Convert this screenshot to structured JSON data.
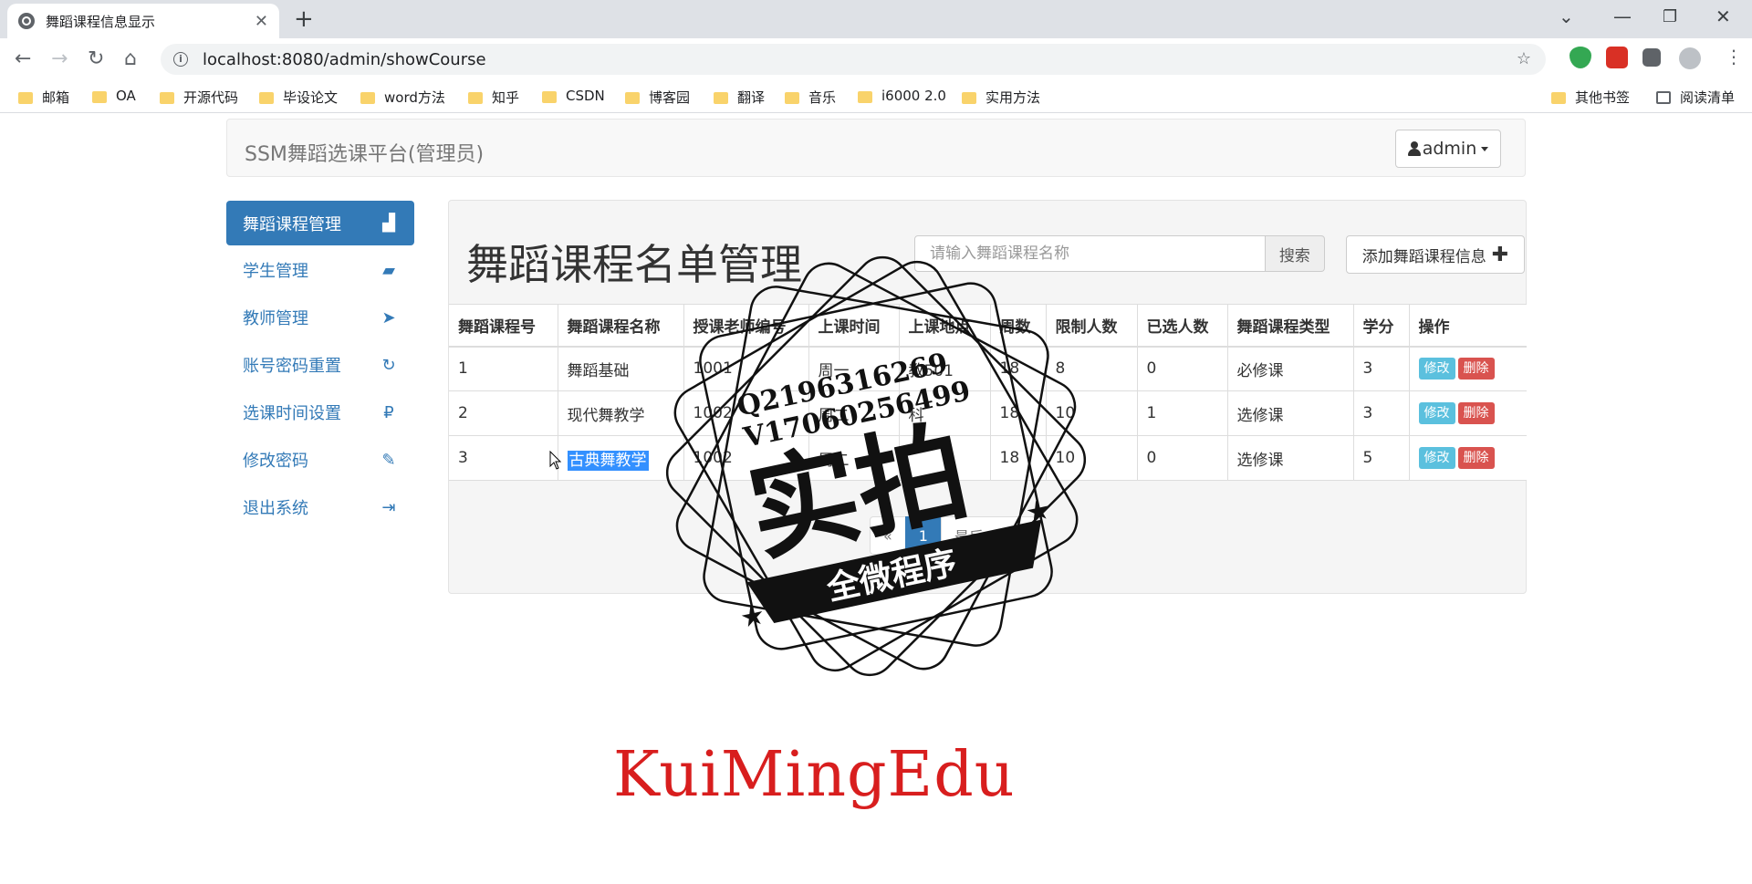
{
  "browser": {
    "tab_title": "舞蹈课程信息显示",
    "url": "localhost:8080/admin/showCourse",
    "bookmarks": [
      "邮箱",
      "OA",
      "开源代码",
      "毕设论文",
      "word方法",
      "知乎",
      "CSDN",
      "博客园",
      "翻译",
      "音乐",
      "i6000 2.0",
      "实用方法"
    ],
    "other_bookmarks": "其他书签",
    "reading_list": "阅读清单"
  },
  "navbar": {
    "brand": "SSM舞蹈选课平台(管理员)",
    "user": "admin"
  },
  "sidebar": {
    "items": [
      {
        "label": "舞蹈课程管理",
        "icon": "bar-chart-icon",
        "glyph": "▟"
      },
      {
        "label": "学生管理",
        "icon": "folder-open-icon",
        "glyph": "📂"
      },
      {
        "label": "教师管理",
        "icon": "send-icon",
        "glyph": "➤"
      },
      {
        "label": "账号密码重置",
        "icon": "refresh-icon",
        "glyph": "↻"
      },
      {
        "label": "选课时间设置",
        "icon": "ruble-icon",
        "glyph": "₽"
      },
      {
        "label": "修改密码",
        "icon": "pencil-icon",
        "glyph": "✎"
      },
      {
        "label": "退出系统",
        "icon": "log-out-icon",
        "glyph": "⇥"
      }
    ]
  },
  "main": {
    "title": "舞蹈课程名单管理",
    "search_placeholder": "请输入舞蹈课程名称",
    "search_button": "搜索",
    "add_button": "添加舞蹈课程信息",
    "table": {
      "headers": [
        "舞蹈课程号",
        "舞蹈课程名称",
        "授课老师编号",
        "上课时间",
        "上课地点",
        "周数",
        "限制人数",
        "已选人数",
        "舞蹈课程类型",
        "学分",
        "操作"
      ],
      "rows": [
        [
          "1",
          "舞蹈基础",
          "1001",
          "周一",
          "教501",
          "18",
          "8",
          "0",
          "必修课",
          "3"
        ],
        [
          "2",
          "现代舞教学",
          "1002",
          "周二",
          "科",
          "18",
          "10",
          "1",
          "选修课",
          "3"
        ],
        [
          "3",
          "古典舞教学",
          "1002",
          "周二",
          "",
          "18",
          "10",
          "0",
          "选修课",
          "5"
        ]
      ],
      "edit_label": "修改",
      "delete_label": "删除"
    },
    "pager": {
      "prev": "«",
      "current": "1",
      "next": "最后一页»"
    }
  },
  "watermark": {
    "qq": "Q2196316269",
    "wechat": "V17060256499",
    "big": "实拍",
    "banner": "全微程序",
    "footer": "KuiMingEdu"
  }
}
